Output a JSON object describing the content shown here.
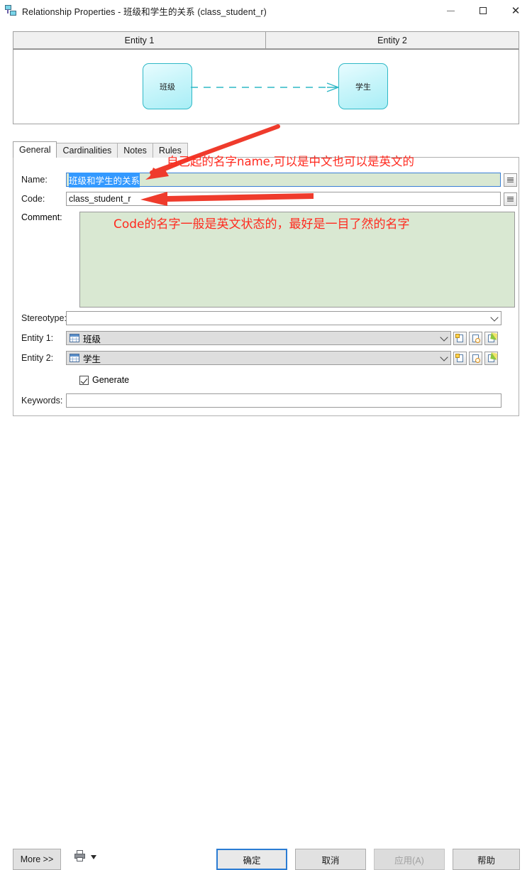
{
  "window": {
    "icon": "relationship-icon",
    "title": "Relationship Properties - 班级和学生的关系 (class_student_r)",
    "minimize_label": "—",
    "maximize_label": "□",
    "close_label": "✕"
  },
  "diagram": {
    "headers": [
      {
        "label": "Entity 1"
      },
      {
        "label": "Entity 2"
      }
    ],
    "entity1_label": "班级",
    "entity2_label": "学生",
    "link_style": "dashed",
    "link_color": "#2fb8c6",
    "link_end_marker": "crows-foot"
  },
  "tabs": [
    {
      "label": "General",
      "active": true
    },
    {
      "label": "Cardinalities",
      "active": false
    },
    {
      "label": "Notes",
      "active": false
    },
    {
      "label": "Rules",
      "active": false
    }
  ],
  "form": {
    "name": {
      "label": "Name:",
      "value": "班级和学生的关系",
      "selected": true,
      "focused": true
    },
    "code": {
      "label": "Code:",
      "value": "class_student_r",
      "focused": false
    },
    "comment": {
      "label": "Comment:",
      "value": ""
    },
    "stereotype": {
      "label": "Stereotype:",
      "value": ""
    },
    "entity1": {
      "label": "Entity 1:",
      "value": "班级",
      "icon": "table-icon"
    },
    "entity2": {
      "label": "Entity 2:",
      "value": "学生",
      "icon": "table-icon"
    },
    "generate": {
      "label": "Generate",
      "checked": true
    },
    "keywords": {
      "label": "Keywords:",
      "value": ""
    },
    "property_button_label": "=",
    "row_buttons": [
      {
        "name": "create-icon"
      },
      {
        "name": "browse-icon"
      },
      {
        "name": "properties-icon"
      }
    ]
  },
  "footer": {
    "more_label": "More >>",
    "print_icon": "print-icon",
    "print_caret": "caret-down-icon",
    "ok_label": "确定",
    "cancel_label": "取消",
    "apply_label": "应用(A)",
    "apply_disabled": true,
    "help_label": "帮助"
  },
  "annotations": {
    "name_note": "自己起的名字name,可以是中文也可以是英文的",
    "code_note": "Code的名字一般是英文状态的，最好是一目了然的名字",
    "color": "#ff2a1f"
  }
}
